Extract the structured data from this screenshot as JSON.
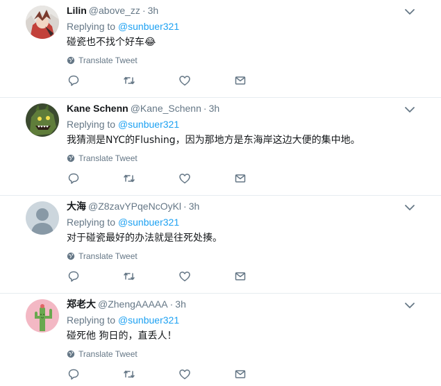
{
  "reply_prefix": "Replying to",
  "translate_label": "Translate Tweet",
  "dot": "·",
  "colors": {
    "link": "#1da1f2",
    "muted": "#657786",
    "text": "#14171a",
    "divider": "#e6ecf0"
  },
  "tweets": [
    {
      "display_name": "Lilin",
      "handle": "@above_zz",
      "time": "3h",
      "reply_to": "@sunbuer321",
      "text": "碰瓷也不找个好车😂",
      "avatar_icon": "anime-character-avatar"
    },
    {
      "display_name": "Kane Schenn",
      "handle": "@Kane_Schenn",
      "time": "3h",
      "reply_to": "@sunbuer321",
      "text": "我猜测是NYC的Flushing，因为那地方是东海岸这边大便的集中地。",
      "avatar_icon": "green-monster-avatar"
    },
    {
      "display_name": "大海",
      "handle": "@Z8zavYPqeNcOyKl",
      "time": "3h",
      "reply_to": "@sunbuer321",
      "text": "对于碰瓷最好的办法就是往死处揍。",
      "avatar_icon": "default-profile-avatar"
    },
    {
      "display_name": "郑老大",
      "handle": "@ZhengAAAAA",
      "time": "3h",
      "reply_to": "@sunbuer321",
      "text": "碰死他 狗日的，直丢人！",
      "avatar_icon": "cactus-avatar"
    }
  ]
}
